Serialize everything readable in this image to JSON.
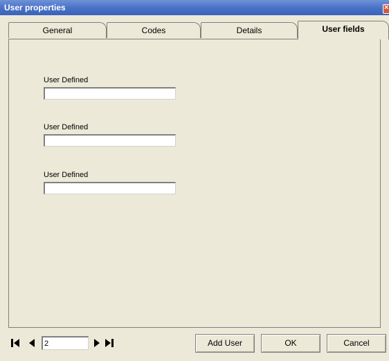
{
  "window": {
    "title": "User properties",
    "close_glyph": "×",
    "accent": "#4a72c8"
  },
  "tabs": [
    {
      "label": "General",
      "active": false
    },
    {
      "label": "Codes",
      "active": false
    },
    {
      "label": "Details",
      "active": false
    },
    {
      "label": "User fields",
      "active": true
    }
  ],
  "fields": [
    {
      "label": "User Defined",
      "value": ""
    },
    {
      "label": "User Defined",
      "value": ""
    },
    {
      "label": "User Defined",
      "value": ""
    }
  ],
  "navigation": {
    "record": "2",
    "icons": [
      "first-record-icon",
      "prev-record-icon",
      "next-record-icon",
      "last-record-icon"
    ]
  },
  "buttons": {
    "add_user": "Add User",
    "ok": "OK",
    "cancel": "Cancel"
  }
}
